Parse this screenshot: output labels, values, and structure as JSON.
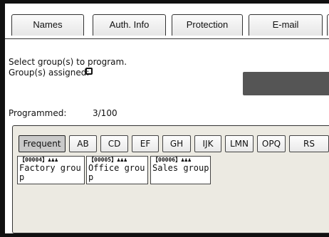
{
  "tabs": [
    {
      "label": "Names"
    },
    {
      "label": "Auth. Info"
    },
    {
      "label": "Protection"
    },
    {
      "label": "E-mail"
    }
  ],
  "prompt": {
    "line1": "Select group(s) to program.",
    "line2": "Group(s) assigned:"
  },
  "programmed": {
    "label": "Programmed:",
    "value": "3/100"
  },
  "index_tabs": [
    {
      "label": "Frequent",
      "active": true
    },
    {
      "label": "AB"
    },
    {
      "label": "CD"
    },
    {
      "label": "EF"
    },
    {
      "label": "GH"
    },
    {
      "label": "IJK"
    },
    {
      "label": "LMN"
    },
    {
      "label": "OPQ"
    },
    {
      "label": "RS"
    }
  ],
  "groups": [
    {
      "id": "【00004】",
      "icon": "group-icon",
      "name": "Factory group"
    },
    {
      "id": "【00005】",
      "icon": "group-icon",
      "name": "Office group"
    },
    {
      "id": "【00006】",
      "icon": "group-icon",
      "name": "Sales group"
    }
  ],
  "colors": {
    "panel": "#eceae2",
    "dark_block": "#555555",
    "active_tab": "#c9c9c9"
  }
}
